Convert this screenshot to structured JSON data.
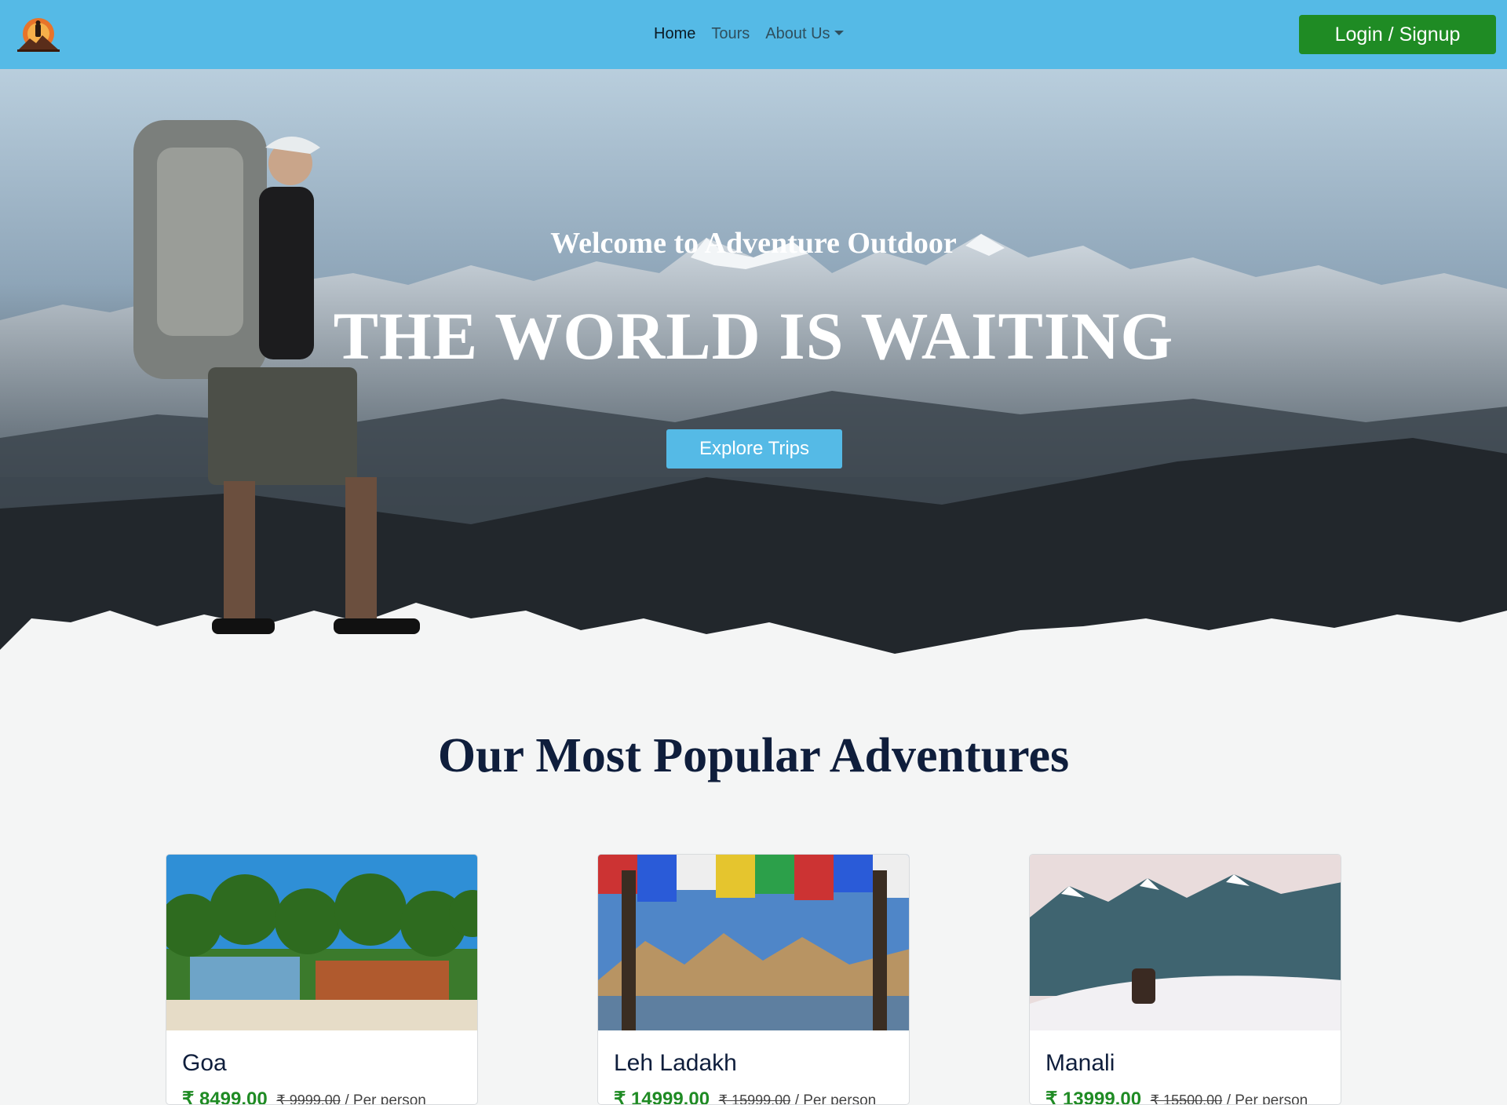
{
  "navbar": {
    "links": [
      {
        "label": "Home"
      },
      {
        "label": "Tours"
      },
      {
        "label": "About Us"
      }
    ],
    "login_label": "Login / Signup",
    "bg_color": "#55bae6",
    "login_color": "#1f8b24"
  },
  "hero": {
    "subtitle": "Welcome to Adventure Outdoor",
    "title": "THE WORLD IS WAITING",
    "button_label": "Explore Trips"
  },
  "popular": {
    "title": "Our Most Popular Adventures",
    "cards": [
      {
        "name": "Goa",
        "price": "₹ 8499.00",
        "old_price": "₹ 9999.00",
        "per": "/ Per person"
      },
      {
        "name": "Leh Ladakh",
        "price": "₹ 14999.00",
        "old_price": "₹ 15999.00",
        "per": "/ Per person"
      },
      {
        "name": "Manali",
        "price": "₹ 13999.00",
        "old_price": "₹ 15500.00",
        "per": "/ Per person"
      }
    ]
  }
}
